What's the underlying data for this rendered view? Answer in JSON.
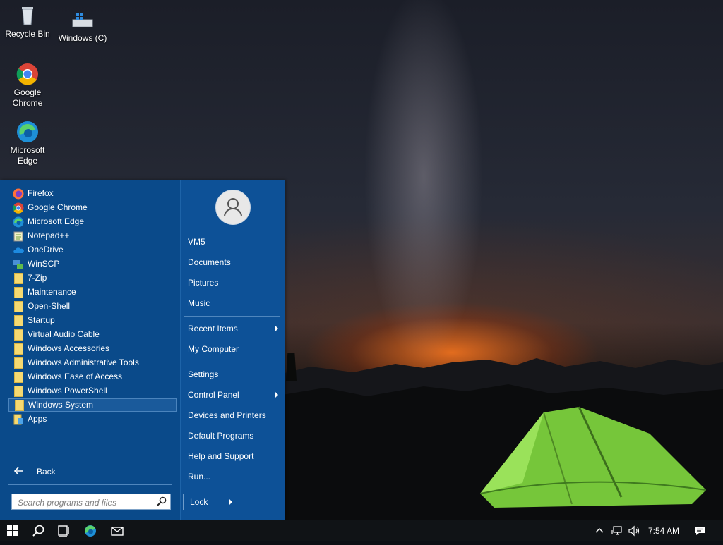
{
  "desktop": {
    "icons": [
      {
        "label": "Recycle Bin",
        "icon": "recycle-bin-icon"
      },
      {
        "label": "Windows (C)",
        "icon": "drive-icon"
      },
      {
        "label": "Google Chrome",
        "icon": "chrome-icon"
      },
      {
        "label": "Microsoft Edge",
        "icon": "edge-icon"
      }
    ]
  },
  "start_menu": {
    "programs": [
      {
        "label": "Firefox",
        "icon": "firefox-icon"
      },
      {
        "label": "Google Chrome",
        "icon": "chrome-icon"
      },
      {
        "label": "Microsoft Edge",
        "icon": "edge-icon"
      },
      {
        "label": "Notepad++",
        "icon": "notepad-plus-plus-icon"
      },
      {
        "label": "OneDrive",
        "icon": "onedrive-icon"
      },
      {
        "label": "WinSCP",
        "icon": "winscp-icon"
      },
      {
        "label": "7-Zip",
        "icon": "folder-icon"
      },
      {
        "label": "Maintenance",
        "icon": "folder-icon"
      },
      {
        "label": "Open-Shell",
        "icon": "folder-icon"
      },
      {
        "label": "Startup",
        "icon": "folder-icon"
      },
      {
        "label": "Virtual Audio Cable",
        "icon": "folder-icon"
      },
      {
        "label": "Windows Accessories",
        "icon": "folder-icon"
      },
      {
        "label": "Windows Administrative Tools",
        "icon": "folder-icon"
      },
      {
        "label": "Windows Ease of Access",
        "icon": "folder-icon"
      },
      {
        "label": "Windows PowerShell",
        "icon": "folder-icon"
      },
      {
        "label": "Windows System",
        "icon": "folder-icon",
        "selected": true
      },
      {
        "label": "Apps",
        "icon": "apps-icon"
      }
    ],
    "back_label": "Back",
    "search_placeholder": "Search programs and files",
    "right_items": {
      "user": "VM5",
      "documents": "Documents",
      "pictures": "Pictures",
      "music": "Music",
      "recent_items": "Recent Items",
      "my_computer": "My Computer",
      "settings": "Settings",
      "control_panel": "Control Panel",
      "devices_printers": "Devices and Printers",
      "default_programs": "Default Programs",
      "help_support": "Help and Support",
      "run": "Run..."
    },
    "lock_label": "Lock"
  },
  "taskbar": {
    "clock": "7:54 AM",
    "icons": [
      "windows-start-icon",
      "search-icon",
      "task-view-icon",
      "edge-icon",
      "mail-icon"
    ],
    "tray_icons": [
      "chevron-up-icon",
      "network-icon",
      "volume-icon",
      "notification-icon"
    ]
  },
  "colors": {
    "menu_bg": "#0a4a8a",
    "selected_bg": "#1a5a9b",
    "taskbar_bg": "#101316"
  }
}
